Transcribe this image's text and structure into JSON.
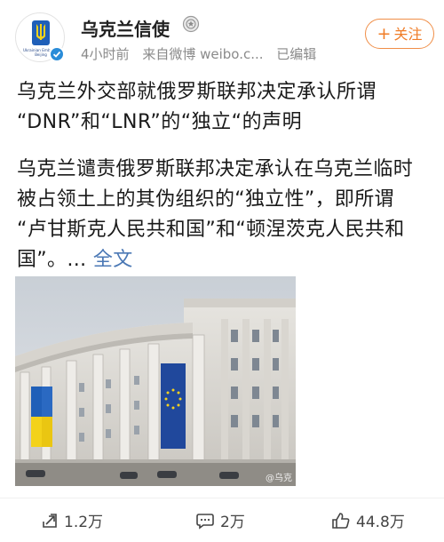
{
  "header": {
    "account_name": "乌克兰信使",
    "avatar_caption_line1": "Ukrainian Embassy",
    "avatar_caption_line2": "Beijing",
    "time_ago": "4小时前",
    "source": "来自微博 weibo.c...",
    "edited": "已编辑",
    "follow_label": "关注",
    "follow_plus": "+"
  },
  "post": {
    "title_line1": "乌克兰外交部就俄罗斯联邦决定承认所谓",
    "title_line2": "“DNR”和“LNR”的“独立“的声明",
    "body_line1": "乌克兰谴责俄罗斯联邦决定承认在乌克兰临时",
    "body_line2": "被占领土上的其伪组织的“独立性”，即所谓",
    "body_line3": "“卢甘斯克人民共和国”和“顿涅茨克人民共和",
    "body_line4_prefix": "国”。… ",
    "full_text_link": "全文",
    "image_watermark": "@乌克"
  },
  "actions": {
    "repost_count": "1.2万",
    "comment_count": "2万",
    "like_count": "44.8万"
  },
  "colors": {
    "accent_orange": "#f07c26",
    "link_blue": "#4b78b5",
    "verified_blue": "#2a8cd8",
    "ukraine_blue": "#1f5fb8",
    "ukraine_yellow": "#f3d21a",
    "eu_blue": "#20489c"
  },
  "icons": [
    "trident-icon",
    "verified-icon",
    "medal-icon",
    "repost-icon",
    "comment-icon",
    "like-icon"
  ]
}
